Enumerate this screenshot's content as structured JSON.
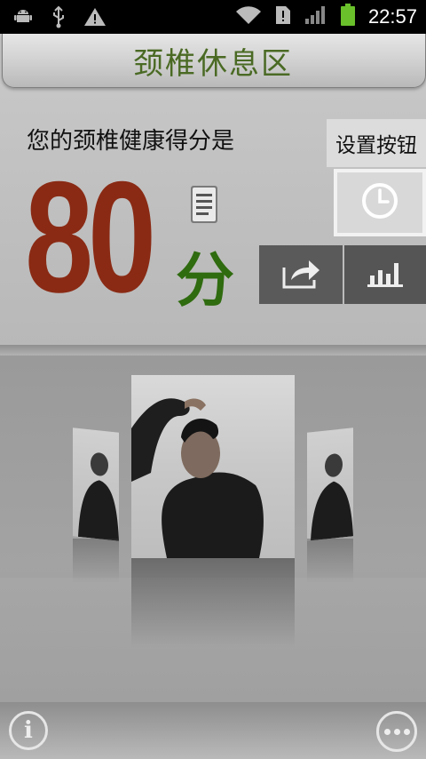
{
  "status_bar": {
    "time": "22:57",
    "icons": [
      "android-debug-icon",
      "usb-icon",
      "warning-icon",
      "wifi-icon",
      "sim-alert-icon",
      "signal-icon",
      "battery-icon"
    ]
  },
  "header": {
    "title": "颈椎休息区"
  },
  "score": {
    "label": "您的颈椎健康得分是",
    "value": "80",
    "unit": "分"
  },
  "settings": {
    "label": "设置按钮"
  },
  "colors": {
    "title": "#4a6a24",
    "score": "#8a2a14",
    "unit": "#2f6b0f"
  }
}
